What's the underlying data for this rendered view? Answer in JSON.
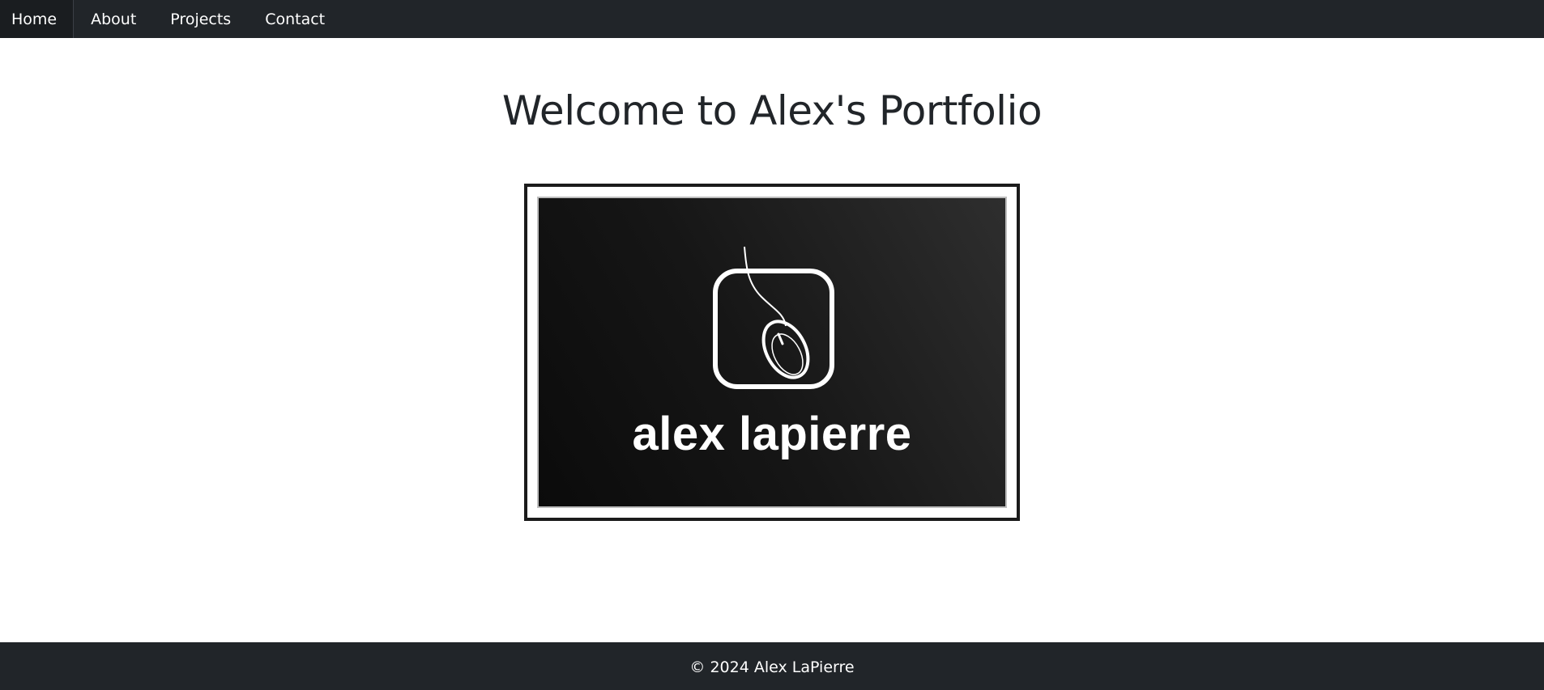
{
  "nav": {
    "items": [
      {
        "label": "Home",
        "active": true
      },
      {
        "label": "About",
        "active": false
      },
      {
        "label": "Projects",
        "active": false
      },
      {
        "label": "Contact",
        "active": false
      }
    ]
  },
  "main": {
    "title": "Welcome to Alex's Portfolio",
    "logo": {
      "icon": "computer-mouse-icon",
      "text": "alex lapierre"
    }
  },
  "footer": {
    "text": "© 2024 Alex LaPierre"
  },
  "colors": {
    "navbar": "#212529",
    "footer": "#212529",
    "title": "#212529",
    "logo_background": "#141414"
  }
}
